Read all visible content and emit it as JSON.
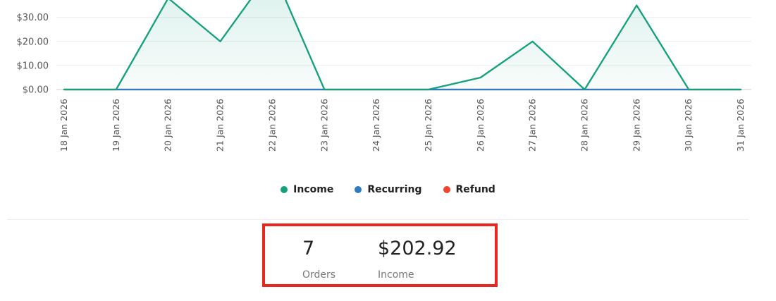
{
  "colors": {
    "income": "#13a07c",
    "recurring": "#2f7bbf",
    "refund": "#f0442c",
    "highlight": "#e8281e"
  },
  "chart_data": {
    "type": "area",
    "x": [
      "18 Jan 2026",
      "19 Jan 2026",
      "20 Jan 2026",
      "21 Jan 2026",
      "22 Jan 2026",
      "23 Jan 2026",
      "24 Jan 2026",
      "25 Jan 2026",
      "26 Jan 2026",
      "27 Jan 2026",
      "28 Jan 2026",
      "29 Jan 2026",
      "30 Jan 2026",
      "31 Jan 2026"
    ],
    "series": [
      {
        "name": "Income",
        "color": "#13a07c",
        "values": [
          0,
          0,
          38,
          20,
          50,
          0,
          0,
          0,
          5,
          20,
          0,
          35,
          0,
          0
        ]
      },
      {
        "name": "Recurring",
        "color": "#2f7bbf",
        "values": [
          0,
          0,
          0,
          0,
          0,
          0,
          0,
          0,
          0,
          0,
          0,
          0,
          0,
          0
        ]
      },
      {
        "name": "Refund",
        "color": "#f0442c",
        "values": [
          0,
          0,
          0,
          0,
          0,
          0,
          0,
          0,
          0,
          0,
          0,
          0,
          0,
          0
        ]
      }
    ],
    "y_ticks": [
      "$0.00",
      "$10.00",
      "$20.00",
      "$30.00"
    ],
    "y_tick_values": [
      0,
      10,
      20,
      30
    ],
    "grid": true,
    "legend_position": "bottom"
  },
  "legend": {
    "income_label": "Income",
    "recurring_label": "Recurring",
    "refund_label": "Refund"
  },
  "summary": {
    "orders_value": "7",
    "orders_label": "Orders",
    "income_value": "$202.92",
    "income_label": "Income"
  }
}
